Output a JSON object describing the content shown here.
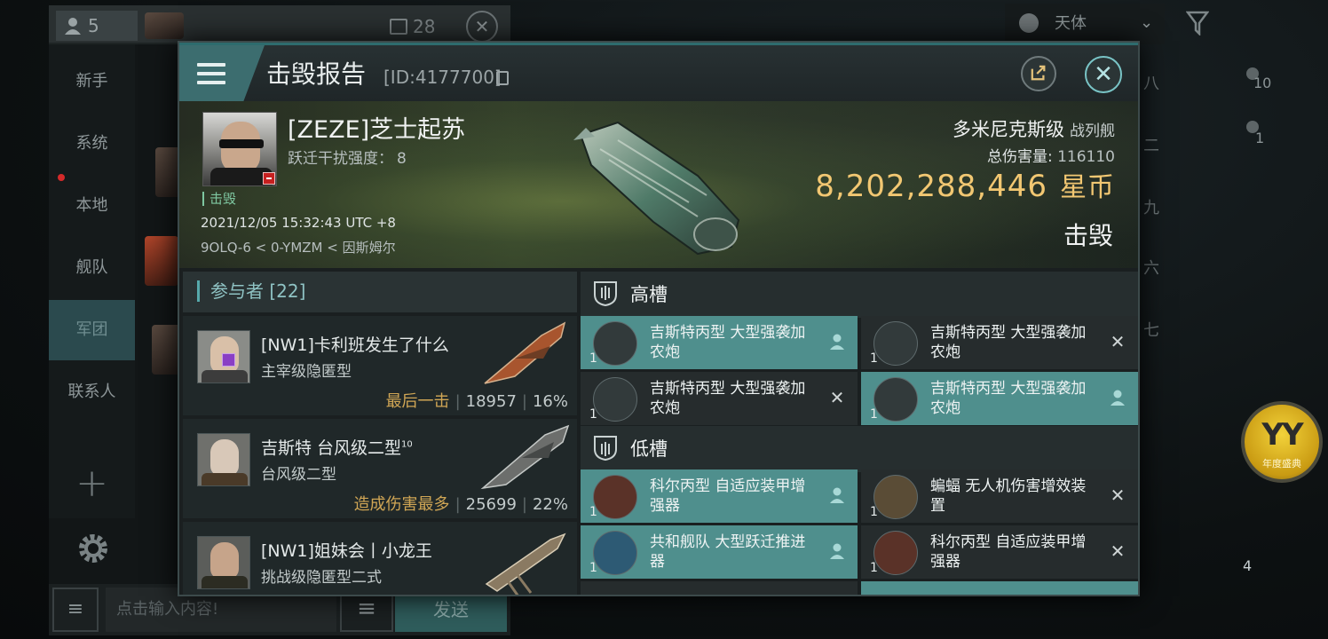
{
  "chat": {
    "member_count": "5",
    "channel_title": "军团",
    "online_count": "28",
    "nav": [
      "新手",
      "系统",
      "本地",
      "舰队",
      "军团",
      "联系人"
    ],
    "input_placeholder": "点击输入内容!",
    "send_label": "发送"
  },
  "background": {
    "celestial_label": "天体",
    "right_labels": [
      "八",
      "二",
      "九",
      "六",
      "七"
    ],
    "right_counts": [
      "10",
      "1"
    ],
    "event_badge": "YY",
    "event_badge_sub": "年度盛典",
    "module_count": "4"
  },
  "dialog": {
    "title": "击毁报告",
    "id_text": "[ID:4177700]"
  },
  "victim": {
    "name": "[ZEZE]芝士起苏",
    "warp_label": "跃迁干扰强度：",
    "warp_value": "8",
    "status_tag": "击毁",
    "time": "2021/12/05 15:32:43 UTC +8",
    "location": "9OLQ-6 < 0-YMZM < 因斯姆尔",
    "ship_name": "多米尼克斯级",
    "ship_class": "战列舰",
    "total_damage_label": "总伤害量:",
    "total_damage": "116110",
    "isk_value": "8,202,288,446",
    "isk_unit": "星币",
    "result": "击毁"
  },
  "participants": {
    "title": "参与者 [22]",
    "rows": [
      {
        "name": "[NW1]卡利班发生了什么",
        "ship": "主宰级隐匿型",
        "tag": "最后一击",
        "damage": "18957",
        "percent": "16%"
      },
      {
        "name": "吉斯特 台风级二型",
        "name_sup": "10",
        "ship": "台风级二型",
        "tag": "造成伤害最多",
        "damage": "25699",
        "percent": "22%"
      },
      {
        "name": "[NW1]姐妹会丨小龙王",
        "ship": "挑战级隐匿型二式",
        "tag": "",
        "damage": "",
        "percent": ""
      }
    ]
  },
  "fittings": {
    "high_title": "高槽",
    "low_title": "低槽",
    "high": [
      {
        "name": "吉斯特丙型 大型强袭加农炮",
        "qty": "1",
        "status": "dropped"
      },
      {
        "name": "吉斯特丙型 大型强袭加农炮",
        "qty": "1",
        "status": "destroyed"
      },
      {
        "name": "吉斯特丙型 大型强袭加农炮",
        "qty": "1",
        "status": "destroyed"
      },
      {
        "name": "吉斯特丙型 大型强袭加农炮",
        "qty": "1",
        "status": "dropped"
      }
    ],
    "low": [
      {
        "name": "科尔丙型 自适应装甲增强器",
        "qty": "1",
        "status": "dropped"
      },
      {
        "name": "蝙蝠 无人机伤害增效装置",
        "qty": "1",
        "status": "destroyed"
      },
      {
        "name": "共和舰队 大型跃迁推进器",
        "qty": "1",
        "status": "dropped"
      },
      {
        "name": "科尔丙型 自适应装甲增强器",
        "qty": "1",
        "status": "destroyed"
      }
    ]
  },
  "colors": {
    "accent": "#4f8f8d",
    "isk": "#f2c772",
    "tag": "#d0a655",
    "destroyed_tag": "#7ec6a0"
  }
}
